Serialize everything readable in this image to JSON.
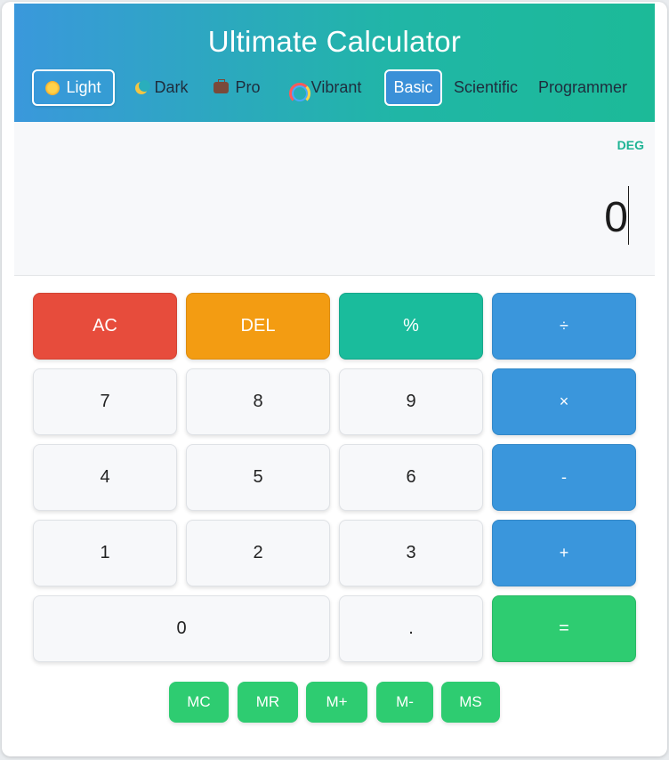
{
  "title": "Ultimate Calculator",
  "themes": [
    {
      "label": "Light",
      "icon": "sun-icon"
    },
    {
      "label": "Dark",
      "icon": "crescent-moon-icon"
    },
    {
      "label": "Pro",
      "icon": "briefcase-icon"
    },
    {
      "label": "Vibrant",
      "icon": "rainbow-icon"
    }
  ],
  "active_theme": "Light",
  "modes": [
    {
      "label": "Basic"
    },
    {
      "label": "Scientific"
    },
    {
      "label": "Programmer"
    }
  ],
  "active_mode": "Basic",
  "display": {
    "angle_unit": "DEG",
    "value": "0"
  },
  "keys": {
    "ac": "AC",
    "del": "DEL",
    "percent": "%",
    "divide": "÷",
    "seven": "7",
    "eight": "8",
    "nine": "9",
    "multiply": "×",
    "four": "4",
    "five": "5",
    "six": "6",
    "minus": "-",
    "one": "1",
    "two": "2",
    "three": "3",
    "plus": "+",
    "zero": "0",
    "dot": ".",
    "equals": "="
  },
  "memory": [
    "MC",
    "MR",
    "M+",
    "M-",
    "MS"
  ],
  "colors": {
    "header_gradient_start": "#3a98dc",
    "header_gradient_end": "#1cba98",
    "clear": "#e74c3c",
    "delete": "#f39c12",
    "percent": "#1abc9c",
    "operator": "#3a96dc",
    "equals": "#2ecc71",
    "memory": "#2ecc71",
    "deg_label": "#1db394"
  }
}
